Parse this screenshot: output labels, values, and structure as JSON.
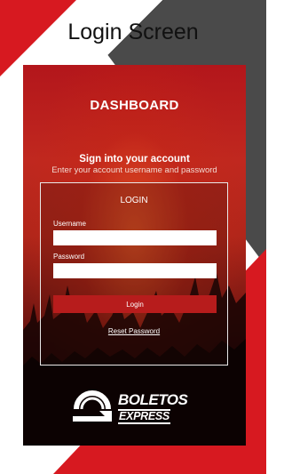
{
  "header": {
    "title": "Login Screen"
  },
  "app": {
    "dashboard_title": "DASHBOARD",
    "signin_heading": "Sign into your account",
    "signin_subtitle": "Enter your account username and password",
    "login_box": {
      "title": "LOGIN",
      "username_label": "Username",
      "username_value": "",
      "password_label": "Password",
      "password_value": "",
      "login_button": "Login",
      "reset_link": "Reset Password"
    },
    "logo": {
      "line1": "BOLETOS",
      "line2": "EXPRESS"
    }
  },
  "colors": {
    "brand_red": "#d71920",
    "button_red": "#b71c1c",
    "dark_grey": "#4a4a4a"
  }
}
